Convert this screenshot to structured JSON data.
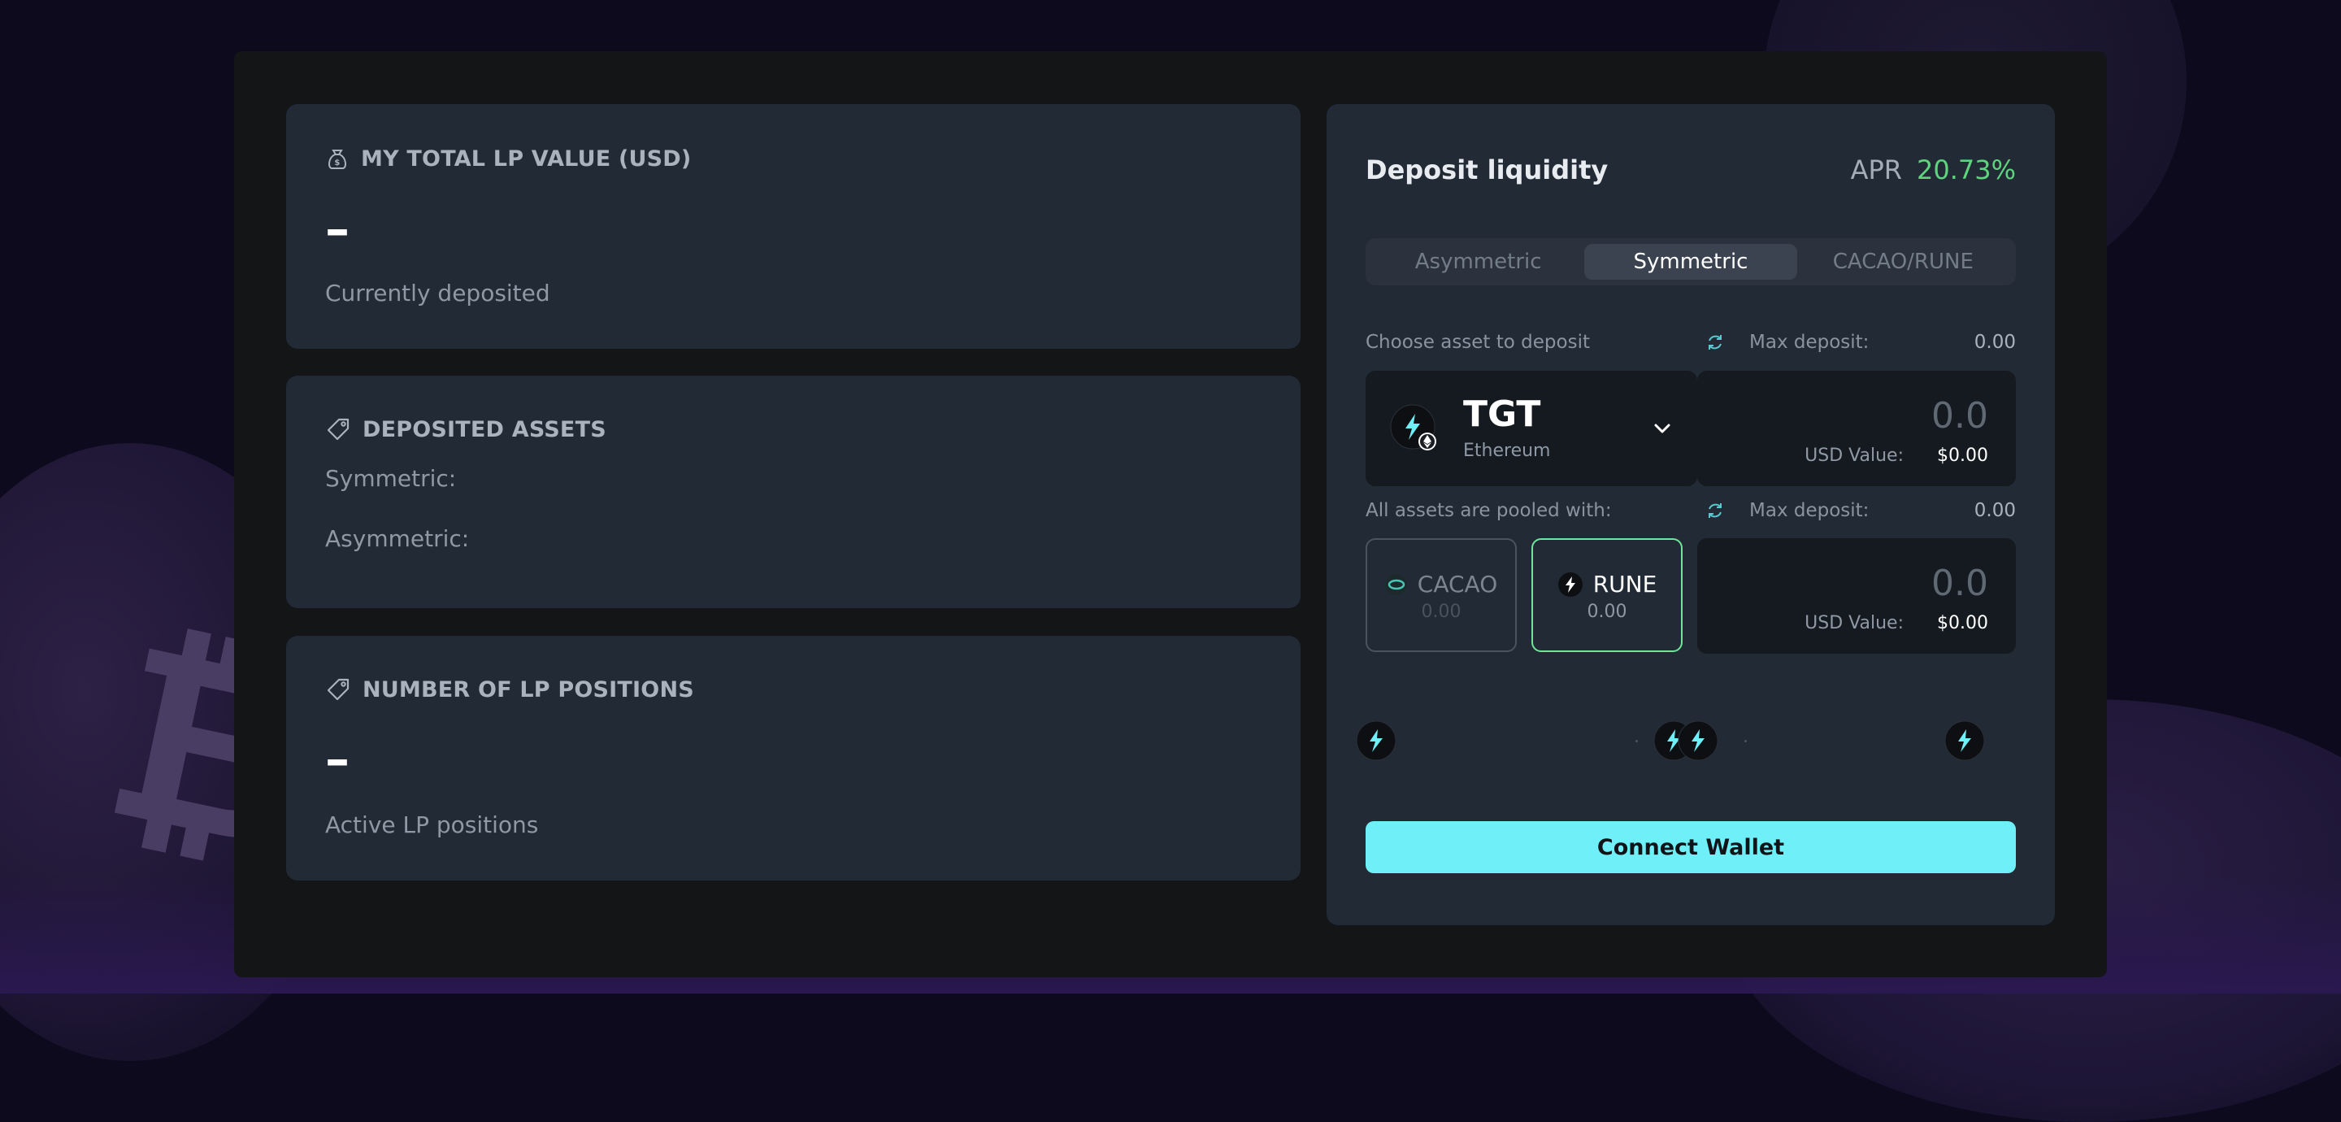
{
  "background": {
    "watermark_glyph": "₿"
  },
  "stats": {
    "total_lp": {
      "title": "MY TOTAL LP VALUE (USD)",
      "value": "–",
      "subtitle": "Currently deposited",
      "icon": "money-bag-icon"
    },
    "deposited_assets": {
      "title": "DEPOSITED ASSETS",
      "symmetric_label": "Symmetric:",
      "asymmetric_label": "Asymmetric:",
      "icon": "tag-icon"
    },
    "lp_positions": {
      "title": "NUMBER OF LP POSITIONS",
      "value": "–",
      "subtitle": "Active LP positions",
      "icon": "tag-icon"
    }
  },
  "deposit": {
    "title": "Deposit liquidity",
    "apr_label": "APR",
    "apr_value": "20.73%",
    "tabs": [
      {
        "label": "Asymmetric",
        "active": false
      },
      {
        "label": "Symmetric",
        "active": true
      },
      {
        "label": "CACAO/RUNE",
        "active": false
      }
    ],
    "choose_label": "Choose asset to deposit",
    "max_label": "Max deposit:",
    "max_value_1": "0.00",
    "asset": {
      "symbol": "TGT",
      "chain": "Ethereum"
    },
    "amount_1": "0.0",
    "usd_label": "USD Value:",
    "usd_value_1": "$0.00",
    "pooled_label": "All assets are pooled with:",
    "max_value_2": "0.00",
    "pool_options": [
      {
        "name": "CACAO",
        "balance": "0.00",
        "selected": false
      },
      {
        "name": "RUNE",
        "balance": "0.00",
        "selected": true
      }
    ],
    "amount_2": "0.0",
    "usd_value_2": "$0.00",
    "connect_label": "Connect Wallet"
  },
  "colors": {
    "accent": "#6ff0f8",
    "apr_green": "#5ed47f",
    "selected_border": "#6ee79a",
    "panel": "#222a35"
  }
}
